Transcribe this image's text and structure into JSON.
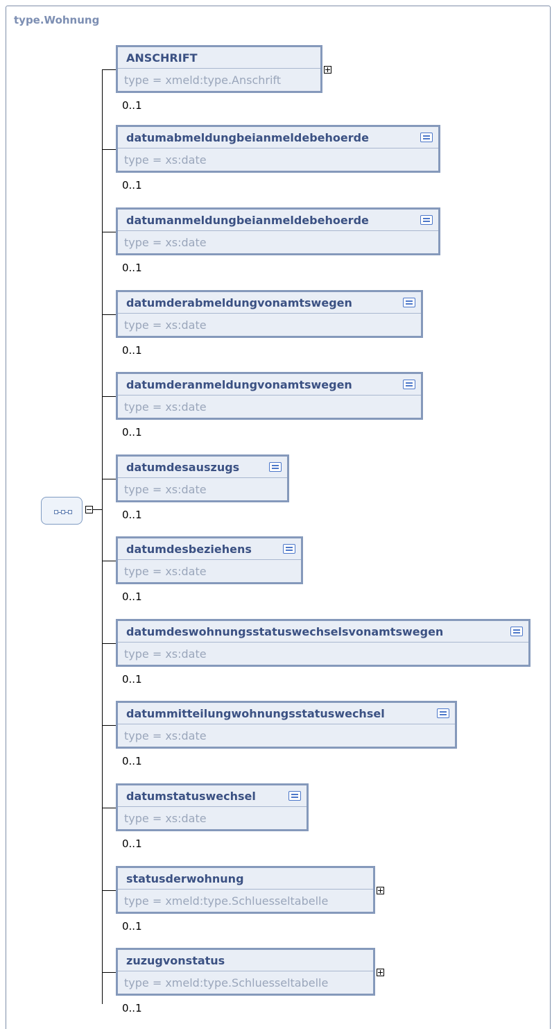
{
  "diagram": {
    "title": "type.Wohnung",
    "compositor": "sequence",
    "elements": [
      {
        "name": "ANSCHRIFT",
        "type": "type = xmeld:type.Anschrift",
        "cardinality": "0..1",
        "expandable": true,
        "documented": false
      },
      {
        "name": "datumabmeldungbeianmeldebehoerde",
        "type": "type = xs:date",
        "cardinality": "0..1",
        "expandable": false,
        "documented": true
      },
      {
        "name": "datumanmeldungbeianmeldebehoerde",
        "type": "type = xs:date",
        "cardinality": "0..1",
        "expandable": false,
        "documented": true
      },
      {
        "name": "datumderabmeldungvonamtswegen",
        "type": "type = xs:date",
        "cardinality": "0..1",
        "expandable": false,
        "documented": true
      },
      {
        "name": "datumderanmeldungvonamtswegen",
        "type": "type = xs:date",
        "cardinality": "0..1",
        "expandable": false,
        "documented": true
      },
      {
        "name": "datumdesauszugs",
        "type": "type = xs:date",
        "cardinality": "0..1",
        "expandable": false,
        "documented": true
      },
      {
        "name": "datumdesbeziehens",
        "type": "type = xs:date",
        "cardinality": "0..1",
        "expandable": false,
        "documented": true
      },
      {
        "name": "datumdeswohnungsstatuswechselsvonamtswegen",
        "type": "type = xs:date",
        "cardinality": "0..1",
        "expandable": false,
        "documented": true
      },
      {
        "name": "datummitteilungwohnungsstatuswechsel",
        "type": "type = xs:date",
        "cardinality": "0..1",
        "expandable": false,
        "documented": true
      },
      {
        "name": "datumstatuswechsel",
        "type": "type = xs:date",
        "cardinality": "0..1",
        "expandable": false,
        "documented": true
      },
      {
        "name": "statusderwohnung",
        "type": "type = xmeld:type.Schluesseltabelle",
        "cardinality": "0..1",
        "expandable": true,
        "documented": false
      },
      {
        "name": "zuzugvonstatus",
        "type": "type = xmeld:type.Schluesseltabelle",
        "cardinality": "0..1",
        "expandable": true,
        "documented": false
      }
    ]
  }
}
